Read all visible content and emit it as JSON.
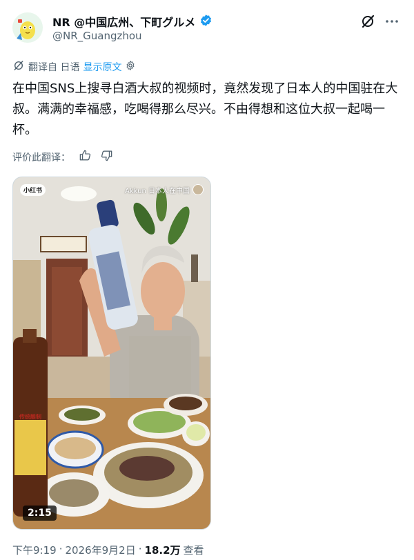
{
  "author": {
    "display_name": "NR @中国広州、下町グルメ",
    "handle": "@NR_Guangzhou",
    "verified": true,
    "verified_color": "#1d9bf0"
  },
  "header_icons": [
    "grok-icon",
    "more-options-icon"
  ],
  "translation": {
    "translated_from": "翻译自 日语",
    "show_original": "显示原文",
    "settings_icon": "gear-icon"
  },
  "tweet": {
    "text": "在中国SNS上搜寻白酒大叔的视频时，竟然发现了日本人的中国驻在大叔。满满的幸福感，吃喝得那么尽兴。不由得想和这位大叔一起喝一杯。"
  },
  "rating": {
    "label": "评价此翻译：",
    "icons": [
      "thumbs-up-icon",
      "thumbs-down-icon"
    ]
  },
  "media": {
    "badge": "小红书",
    "watermark": "Akkun 日本人在中国",
    "bottle_label": "传统酿制",
    "duration": "2:15"
  },
  "meta": {
    "time": "下午9:19",
    "separator": "·",
    "date": "2026年9月2日",
    "views_count": "18.2万",
    "views_label": "查看"
  },
  "colors": {
    "text_primary": "#0f1419",
    "text_secondary": "#536471",
    "link": "#1d9bf0"
  }
}
